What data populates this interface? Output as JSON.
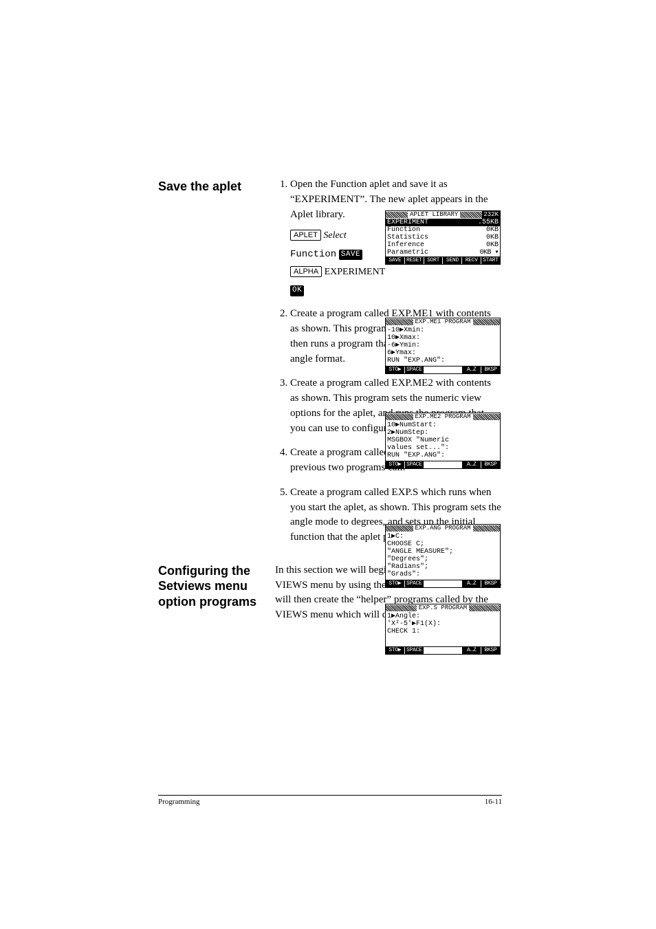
{
  "sections": {
    "save_aplet": {
      "heading": "Save the aplet",
      "step1": "Open the Function aplet and save it as “EXPERIMENT”. The new aplet appears in the Aplet library.",
      "keys": {
        "aplet": "APLET",
        "select": "Select",
        "function_word": "Function",
        "save_chip": "SAVE",
        "alpha": "ALPHA",
        "experiment": "EXPERIMENT",
        "ok_chip": "OK"
      },
      "step2": "Create a program called EXP.ME1 with contents as shown. This program configures the plot ranges, then runs a program that allows you to set the angle format.",
      "step3": "Create a program called EXP.ME2 with contents as shown. This program sets the numeric view options for the aplet, and runs the program that you can use to configure the angle mode.",
      "step4": "Create a program called EXP.ANG which the previous two programs call.",
      "step5": "Create a program called EXP.S which runs when you start the aplet, as shown. This program sets the angle mode to degrees, and sets up the initial function that the aplet plots."
    },
    "configuring": {
      "heading": "Configuring the Setviews menu option programs",
      "body": "In this section we will begin by configuring the VIEWS menu by using the SETVIEWS command. We will then create the “helper” programs called by the VIEWS menu which will do the actual work."
    }
  },
  "screens": {
    "library": {
      "title": "APLET LIBRARY",
      "mem": "232K",
      "highlight_name": "EXPERIMENT",
      "highlight_size": ".55KB",
      "rows": [
        {
          "name": "Function",
          "size": "0KB"
        },
        {
          "name": "Statistics",
          "size": "0KB"
        },
        {
          "name": "Inference",
          "size": "0KB"
        },
        {
          "name": "Parametric",
          "size": "0KB"
        }
      ],
      "menu": [
        "SAVE",
        "RESET",
        "SORT",
        "SEND",
        "RECV",
        "START"
      ]
    },
    "me1": {
      "title": "EXP.ME1 PROGRAM",
      "body": "-10▶Xmin:\n10▶Xmax:\n-6▶Ymin:\n6▶Ymax:\nRUN \"EXP.ANG\":",
      "menu": [
        "STO▶",
        "SPACE",
        "",
        "",
        "A…Z",
        "BKSP"
      ]
    },
    "me2": {
      "title": "EXP.ME2 PROGRAM",
      "body": "10▶NumStart:\n2▶NumStep:\nMSGBOX \"Numeric\nvalues set...\":\nRUN \"EXP.ANG\":",
      "menu": [
        "STO▶",
        "SPACE",
        "",
        "",
        "A…Z",
        "BKSP"
      ]
    },
    "ang": {
      "title": "EXP.ANG PROGRAM",
      "body": "1▶C:\nCHOOSE C;\n\"ANGLE MEASURE\";\n\"Degrees\";\n\"Radians\";\n\"Grads\":",
      "menu": [
        "STO▶",
        "SPACE",
        "",
        "",
        "A…Z",
        "BKSP"
      ]
    },
    "s": {
      "title": "EXP.S PROGRAM",
      "body": "1▶Angle:\n'X²-5'▶F1(X):\nCHECK 1:",
      "menu": [
        "STO▶",
        "SPACE",
        "",
        "",
        "A…Z",
        "BKSP"
      ]
    }
  },
  "footer": {
    "left": "Programming",
    "right": "16-11"
  }
}
